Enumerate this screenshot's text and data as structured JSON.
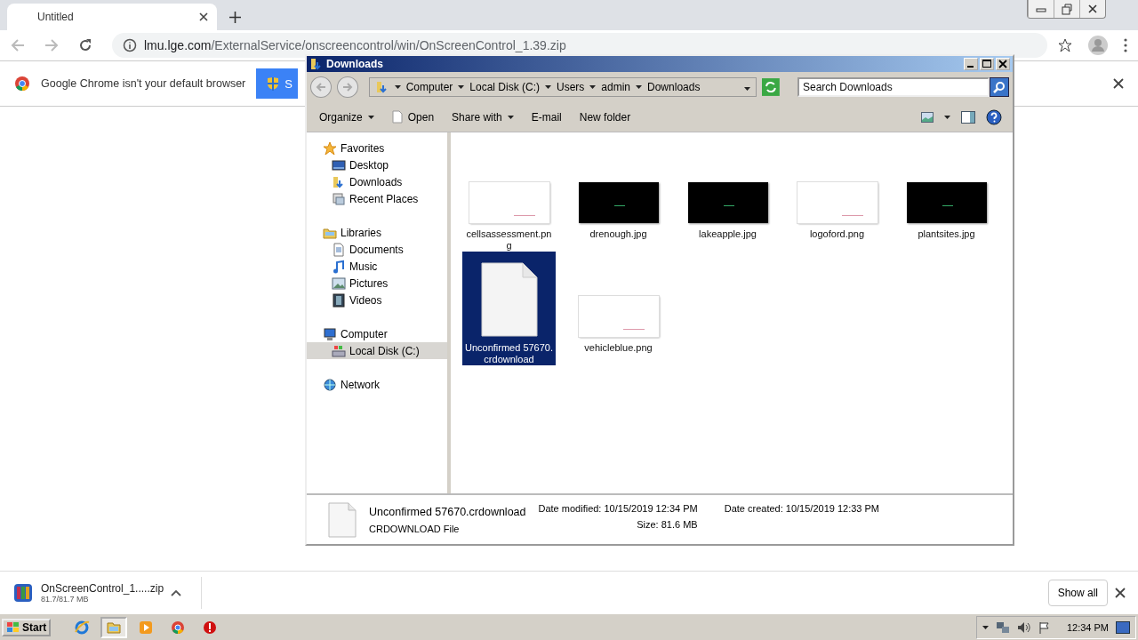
{
  "browser": {
    "tab": {
      "title": "Untitled",
      "selected": true
    },
    "address": {
      "host": "lmu.lge.com",
      "path": "/ExternalService/onscreencontrol/win/OnScreenControl_1.39.zip"
    },
    "infobar": {
      "message": "Google Chrome isn't your default browser",
      "button": "S"
    }
  },
  "explorer": {
    "title": "Downloads",
    "breadcrumb": [
      "Computer",
      "Local Disk (C:)",
      "Users",
      "admin",
      "Downloads"
    ],
    "search": {
      "placeholder": "Search Downloads"
    },
    "toolbar": [
      {
        "label": "Organize",
        "kind": "menu"
      },
      {
        "label": "Open",
        "kind": "open"
      },
      {
        "label": "Share with",
        "kind": "menu"
      },
      {
        "label": "E-mail",
        "kind": "plain"
      },
      {
        "label": "New folder",
        "kind": "plain"
      }
    ],
    "nav": [
      {
        "label": "Favorites",
        "kind": "star",
        "selected": false,
        "children": [
          {
            "label": "Desktop",
            "kind": "desktop",
            "selected": false
          },
          {
            "label": "Downloads",
            "kind": "folder",
            "selected": false
          },
          {
            "label": "Recent Places",
            "kind": "recent",
            "selected": false
          }
        ]
      },
      {
        "label": "Libraries",
        "kind": "library",
        "selected": false,
        "children": [
          {
            "label": "Documents",
            "kind": "document",
            "selected": false
          },
          {
            "label": "Music",
            "kind": "music",
            "selected": false
          },
          {
            "label": "Pictures",
            "kind": "pictures",
            "selected": false
          },
          {
            "label": "Videos",
            "kind": "videos",
            "selected": false
          }
        ]
      },
      {
        "label": "Computer",
        "kind": "computer",
        "selected": false,
        "children": [
          {
            "label": "Local Disk (C:)",
            "kind": "disk",
            "selected": true
          }
        ]
      },
      {
        "label": "Network",
        "kind": "network",
        "selected": false
      }
    ],
    "files": [
      {
        "name": "cellsassessment.png",
        "kind": "light",
        "selected": false
      },
      {
        "name": "drenough.jpg",
        "kind": "dark",
        "selected": false
      },
      {
        "name": "lakeapple.jpg",
        "kind": "dark",
        "selected": false
      },
      {
        "name": "logoford.png",
        "kind": "light",
        "selected": false
      },
      {
        "name": "plantsites.jpg",
        "kind": "dark",
        "selected": false
      },
      {
        "name": "Unconfirmed 57670.crdownload",
        "kind": "document",
        "selected": true
      },
      {
        "name": "vehicleblue.png",
        "kind": "light",
        "selected": false
      }
    ],
    "details": {
      "name": "Unconfirmed 57670.crdownload",
      "type": "CRDOWNLOAD File",
      "fields": [
        {
          "label": "Date modified:",
          "value": "10/15/2019 12:34 PM"
        },
        {
          "label": "Size:",
          "value": "81.6 MB"
        },
        {
          "label": "Date created:",
          "value": "10/15/2019 12:33 PM"
        }
      ]
    }
  },
  "download_shelf": {
    "file": "OnScreenControl_1.....zip",
    "progress": "81.7/81.7 MB",
    "show_all": "Show all"
  },
  "taskbar": {
    "start": "Start",
    "apps": [
      {
        "kind": "ie",
        "selected": false
      },
      {
        "kind": "explorer",
        "selected": true
      },
      {
        "kind": "media",
        "selected": false
      },
      {
        "kind": "chrome",
        "selected": false
      },
      {
        "kind": "stop",
        "selected": false
      }
    ],
    "clock": "12:34 PM"
  }
}
